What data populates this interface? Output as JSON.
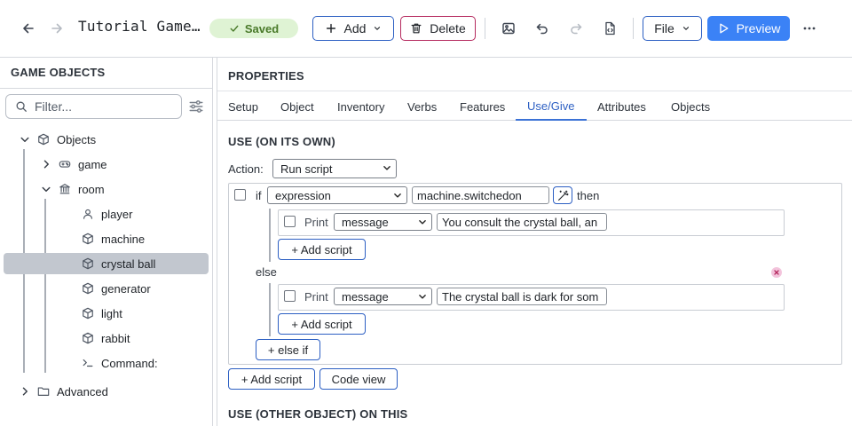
{
  "toolbar": {
    "back_icon": "arrow-left-icon",
    "forward_icon": "arrow-right-icon",
    "title": "Tutorial Game…",
    "saved_label": "Saved",
    "add_label": "Add",
    "delete_label": "Delete",
    "file_label": "File",
    "preview_label": "Preview",
    "accent_color": "#3b82f6",
    "danger_color": "#b5295e"
  },
  "sidebar": {
    "header": "GAME OBJECTS",
    "filter_placeholder": "Filter...",
    "tree": {
      "objects": "Objects",
      "game": "game",
      "room": "room",
      "children": [
        "player",
        "machine",
        "crystal ball",
        "generator",
        "light",
        "rabbit",
        "Command:"
      ],
      "advanced": "Advanced"
    },
    "selected": "crystal ball"
  },
  "main": {
    "properties_title": "PROPERTIES",
    "tabs": [
      "Setup",
      "Object",
      "Inventory",
      "Verbs",
      "Features",
      "Use/Give",
      "Attributes",
      "Objects"
    ],
    "active_tab": "Use/Give",
    "use_on_own": {
      "title": "USE (ON ITS OWN)",
      "action_label": "Action:",
      "action_value": "Run script",
      "if_label": "if",
      "condition_type": "expression",
      "condition_value": "machine.switchedon",
      "then_label": "then",
      "then_print_label": "Print",
      "then_print_type": "message",
      "then_print_text": "You consult the crystal ball, an",
      "add_script_label": "+ Add script",
      "else_label": "else",
      "else_print_label": "Print",
      "else_print_type": "message",
      "else_print_text": "The crystal ball is dark for som",
      "else_add_script_label": "+ Add script",
      "else_if_label": "+ else if",
      "outer_add_script_label": "+ Add script",
      "code_view_label": "Code view"
    },
    "use_other_title": "USE (OTHER OBJECT) ON THIS"
  }
}
